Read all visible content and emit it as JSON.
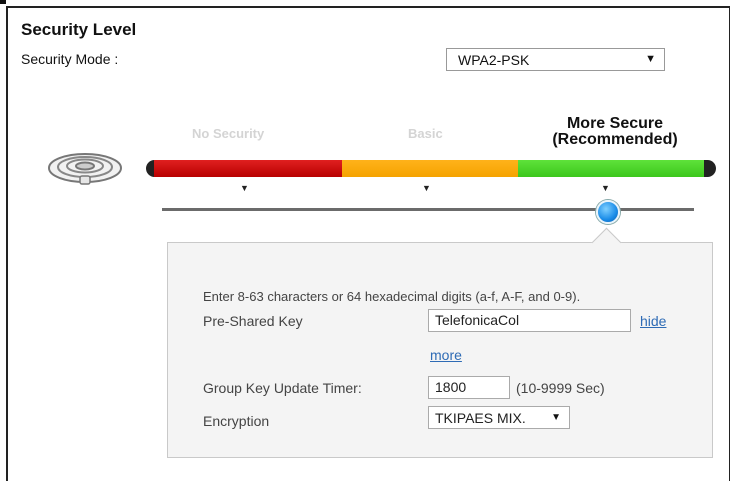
{
  "security": {
    "title": "Security Level",
    "mode_label": "Security Mode :",
    "mode_value": "WPA2-PSK",
    "levels": {
      "none": "No Security",
      "basic": "Basic",
      "more_line1": "More Secure",
      "more_line2": "(Recommended)"
    },
    "slider_position": "More Secure",
    "colors": {
      "red": "#d41010",
      "orange": "#ffaa00",
      "green": "#4cd42a",
      "handle": "#1a8ce8"
    }
  },
  "panel": {
    "hint": "Enter 8-63 characters or 64 hexadecimal digits (a-f, A-F, and 0-9).",
    "psk_label": "Pre-Shared Key",
    "psk_value": "TelefonicaCol",
    "hide_link": "hide",
    "more_link": "more",
    "timer_label": "Group Key Update Timer:",
    "timer_value": "1800",
    "timer_range": "(10-9999 Sec)",
    "encryption_label": "Encryption",
    "encryption_value": "TKIPAES MIX."
  },
  "icons": {
    "wifi": "wifi-router-icon",
    "dropdown": "chevron-down-icon",
    "tick": "triangle-down-icon"
  }
}
